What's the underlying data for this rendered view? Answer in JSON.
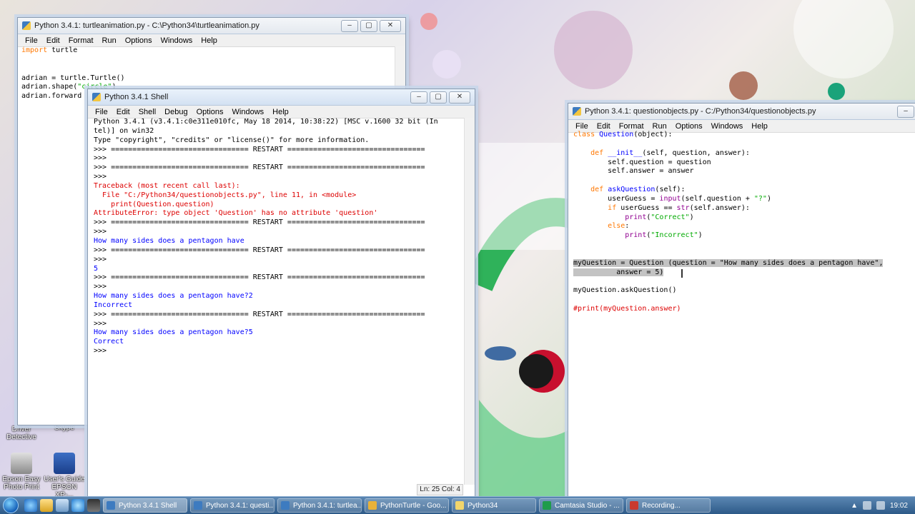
{
  "desktop": {
    "icons": [
      {
        "label": "Driver Detective"
      },
      {
        "label": "Skype"
      },
      {
        "label": "Epson Easy Photo Print"
      },
      {
        "label": "User's Guide EPSON XP-..."
      }
    ]
  },
  "turtle_window": {
    "title": "Python 3.4.1: turtleanimation.py - C:\\Python34\\turtleanimation.py",
    "menu": [
      "File",
      "Edit",
      "Format",
      "Run",
      "Options",
      "Windows",
      "Help"
    ],
    "lines": [
      [
        {
          "t": "import",
          "c": "kw"
        },
        {
          "t": " turtle",
          "c": ""
        }
      ],
      [],
      [],
      [
        {
          "t": "adrian = turtle.Turtle()",
          "c": ""
        }
      ],
      [
        {
          "t": "adrian.shape(",
          "c": ""
        },
        {
          "t": "\"circle\"",
          "c": "str"
        },
        {
          "t": ")",
          "c": ""
        }
      ],
      [
        {
          "t": "adrian.forward",
          "c": ""
        }
      ]
    ]
  },
  "shell_window": {
    "title": "Python 3.4.1 Shell",
    "menu": [
      "File",
      "Edit",
      "Shell",
      "Debug",
      "Options",
      "Windows",
      "Help"
    ],
    "status": "Ln: 25 Col: 4",
    "lines": [
      [
        {
          "t": "Python 3.4.1 (v3.4.1:c0e311e010fc, May 18 2014, 10:38:22) [MSC v.1600 32 bit (In",
          "c": ""
        }
      ],
      [
        {
          "t": "tel)] on win32",
          "c": ""
        }
      ],
      [
        {
          "t": "Type \"copyright\", \"credits\" or \"license()\" for more information.",
          "c": ""
        }
      ],
      [
        {
          "t": ">>> ================================ RESTART ================================",
          "c": ""
        }
      ],
      [
        {
          "t": ">>>",
          "c": ""
        }
      ],
      [
        {
          "t": ">>> ================================ RESTART ================================",
          "c": ""
        }
      ],
      [
        {
          "t": ">>>",
          "c": ""
        }
      ],
      [
        {
          "t": "Traceback (most recent call last):",
          "c": "err"
        }
      ],
      [
        {
          "t": "  File \"C:/Python34/questionobjects.py\", line 11, in <module>",
          "c": "err"
        }
      ],
      [
        {
          "t": "    print(Question.question)",
          "c": "err"
        }
      ],
      [
        {
          "t": "AttributeError: type object 'Question' has no attribute 'question'",
          "c": "err"
        }
      ],
      [
        {
          "t": ">>> ================================ RESTART ================================",
          "c": ""
        }
      ],
      [
        {
          "t": ">>>",
          "c": ""
        }
      ],
      [
        {
          "t": "How many sides does a pentagon have",
          "c": "out"
        }
      ],
      [
        {
          "t": ">>> ================================ RESTART ================================",
          "c": ""
        }
      ],
      [
        {
          "t": ">>>",
          "c": ""
        }
      ],
      [
        {
          "t": "5",
          "c": "out"
        }
      ],
      [
        {
          "t": ">>> ================================ RESTART ================================",
          "c": ""
        }
      ],
      [
        {
          "t": ">>>",
          "c": ""
        }
      ],
      [
        {
          "t": "How many sides does a pentagon have?2",
          "c": "out"
        }
      ],
      [
        {
          "t": "Incorrect",
          "c": "out"
        }
      ],
      [
        {
          "t": ">>> ================================ RESTART ================================",
          "c": ""
        }
      ],
      [
        {
          "t": ">>>",
          "c": ""
        }
      ],
      [
        {
          "t": "How many sides does a pentagon have?5",
          "c": "out"
        }
      ],
      [
        {
          "t": "Correct",
          "c": "out"
        }
      ],
      [
        {
          "t": ">>> ",
          "c": ""
        }
      ]
    ]
  },
  "question_window": {
    "title": "Python 3.4.1: questionobjects.py - C:/Python34/questionobjects.py",
    "menu": [
      "File",
      "Edit",
      "Format",
      "Run",
      "Options",
      "Windows",
      "Help"
    ],
    "lines": [
      [
        {
          "t": "class",
          "c": "kw"
        },
        {
          "t": " ",
          "c": ""
        },
        {
          "t": "Question",
          "c": "def"
        },
        {
          "t": "(object):",
          "c": ""
        }
      ],
      [],
      [
        {
          "t": "    ",
          "c": ""
        },
        {
          "t": "def",
          "c": "kw"
        },
        {
          "t": " ",
          "c": ""
        },
        {
          "t": "__init__",
          "c": "def"
        },
        {
          "t": "(self, question, answer):",
          "c": ""
        }
      ],
      [
        {
          "t": "        self.question = question",
          "c": ""
        }
      ],
      [
        {
          "t": "        self.answer = answer",
          "c": ""
        }
      ],
      [],
      [
        {
          "t": "    ",
          "c": ""
        },
        {
          "t": "def",
          "c": "kw"
        },
        {
          "t": " ",
          "c": ""
        },
        {
          "t": "askQuestion",
          "c": "def"
        },
        {
          "t": "(self):",
          "c": ""
        }
      ],
      [
        {
          "t": "        userGuess = ",
          "c": ""
        },
        {
          "t": "input",
          "c": "bi"
        },
        {
          "t": "(self.question + ",
          "c": ""
        },
        {
          "t": "\"?\"",
          "c": "str"
        },
        {
          "t": ")",
          "c": ""
        }
      ],
      [
        {
          "t": "        ",
          "c": ""
        },
        {
          "t": "if",
          "c": "kw"
        },
        {
          "t": " userGuess == ",
          "c": ""
        },
        {
          "t": "str",
          "c": "bi"
        },
        {
          "t": "(self.answer):",
          "c": ""
        }
      ],
      [
        {
          "t": "            ",
          "c": ""
        },
        {
          "t": "print",
          "c": "bi"
        },
        {
          "t": "(",
          "c": ""
        },
        {
          "t": "\"Correct\"",
          "c": "str"
        },
        {
          "t": ")",
          "c": ""
        }
      ],
      [
        {
          "t": "        ",
          "c": ""
        },
        {
          "t": "else",
          "c": "kw"
        },
        {
          "t": ":",
          "c": ""
        }
      ],
      [
        {
          "t": "            ",
          "c": ""
        },
        {
          "t": "print",
          "c": "bi"
        },
        {
          "t": "(",
          "c": ""
        },
        {
          "t": "\"Incorrect\"",
          "c": "str"
        },
        {
          "t": ")",
          "c": ""
        }
      ],
      [],
      [],
      [
        {
          "t": "myQuestion = Question (question = \"How many sides does a pentagon have\",",
          "c": "sel"
        }
      ],
      [
        {
          "t": "          answer = 5)",
          "c": "sel"
        }
      ],
      [],
      [
        {
          "t": "myQuestion.askQuestion()",
          "c": ""
        }
      ],
      [],
      [
        {
          "t": "#print(myQuestion.answer)",
          "c": "cm"
        }
      ]
    ]
  },
  "taskbar": {
    "tasks": [
      {
        "label": "Python 3.4.1 Shell",
        "active": true
      },
      {
        "label": "Python 3.4.1: questi...",
        "active": false
      },
      {
        "label": "Python 3.4.1: turtlea...",
        "active": false
      },
      {
        "label": "PythonTurtle - Goo...",
        "active": false
      },
      {
        "label": "Python34",
        "active": false
      },
      {
        "label": "Camtasia Studio - ...",
        "active": false
      },
      {
        "label": "Recording...",
        "active": false
      }
    ],
    "clock": "19:02"
  },
  "colors": {
    "keyword": "#ff7700",
    "definition": "#0000ff",
    "string": "#00aa00",
    "builtin": "#900090",
    "error": "#dd0000",
    "output": "#0000ff",
    "selection": "#c3c3c3"
  }
}
